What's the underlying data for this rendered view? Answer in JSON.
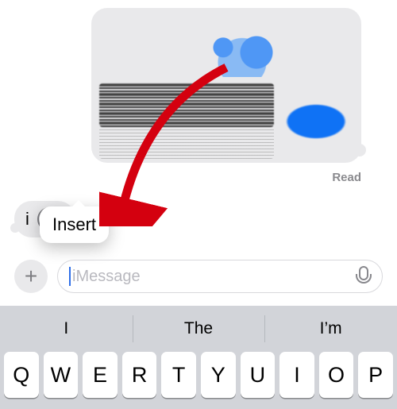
{
  "message": {
    "read_receipt": "Read"
  },
  "typed": {
    "text": "i"
  },
  "popover": {
    "label": "Insert"
  },
  "compose": {
    "placeholder": "iMessage"
  },
  "keyboard": {
    "suggestions": [
      "I",
      "The",
      "I’m"
    ],
    "row1": [
      "Q",
      "W",
      "E",
      "R",
      "T",
      "Y",
      "U",
      "I",
      "O",
      "P"
    ]
  }
}
